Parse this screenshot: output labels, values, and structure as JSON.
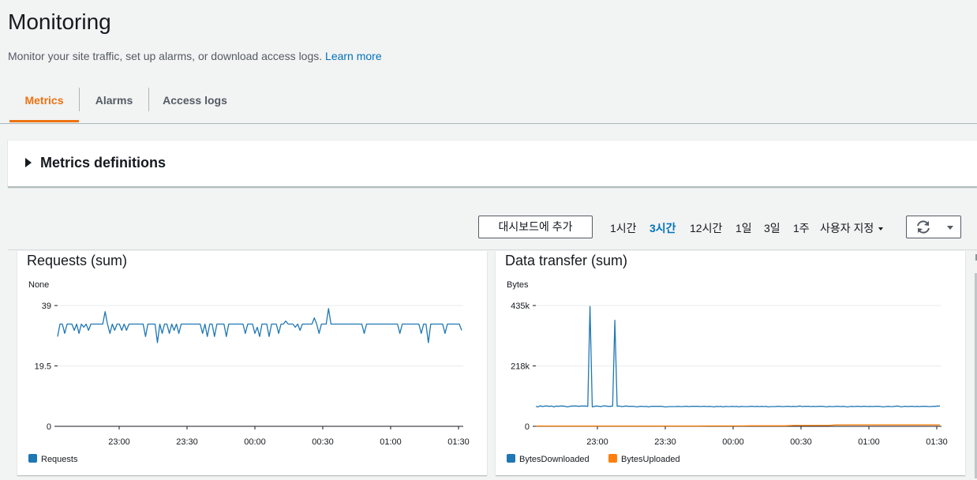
{
  "header": {
    "title": "Monitoring",
    "subtitle": "Monitor your site traffic, set up alarms, or download access logs.",
    "learn_more": "Learn more"
  },
  "tabs": [
    {
      "label": "Metrics",
      "active": true
    },
    {
      "label": "Alarms",
      "active": false
    },
    {
      "label": "Access logs",
      "active": false
    }
  ],
  "definitions": {
    "label": "Metrics definitions"
  },
  "toolbar": {
    "add_dashboard": "대시보드에 추가",
    "ranges": [
      "1시간",
      "3시간",
      "12시간",
      "1일",
      "3일",
      "1주"
    ],
    "active_range": "3시간",
    "custom": "사용자 지정"
  },
  "colors": {
    "accent": "#ec7211",
    "link": "#0073bb",
    "series1": "#1f77b4",
    "series2": "#ff7f0e"
  },
  "icons": {
    "refresh": "refresh-icon",
    "dropdown": "chevron-down-icon",
    "expand": "caret-right-icon"
  },
  "panels": [
    {
      "title": "Requests (sum)",
      "unit": "None",
      "legend": [
        "Requests"
      ]
    },
    {
      "title": "Data transfer (sum)",
      "unit": "Bytes",
      "legend": [
        "BytesDownloaded",
        "BytesUploaded"
      ]
    }
  ],
  "chart_data": [
    {
      "type": "line",
      "title": "Requests (sum)",
      "ylabel": "None",
      "ylim": [
        0,
        39
      ],
      "yticks": [
        "0",
        "19.5",
        "39"
      ],
      "xticks": [
        "23:00",
        "23:30",
        "00:00",
        "00:30",
        "01:00",
        "01:30"
      ],
      "grid": true,
      "legend_position": "bottom-left",
      "series": [
        {
          "name": "Requests",
          "color": "#1f77b4",
          "values": [
            29,
            33,
            33,
            30,
            33,
            33,
            33,
            31,
            33,
            30,
            33,
            32,
            33,
            31,
            33,
            33,
            33,
            33,
            33,
            33,
            37,
            33,
            30,
            33,
            31,
            33,
            33,
            31,
            33,
            31,
            33,
            33,
            33,
            33,
            33,
            33,
            33,
            29,
            33,
            33,
            33,
            33,
            27,
            33,
            30,
            33,
            33,
            30,
            33,
            31,
            33,
            30,
            33,
            33,
            33,
            33,
            33,
            33,
            33,
            33,
            33,
            30,
            33,
            29,
            33,
            33,
            29,
            33,
            33,
            33,
            33,
            29,
            33,
            33,
            33,
            33,
            33,
            33,
            33,
            30,
            33,
            33,
            33,
            30,
            32,
            29,
            33,
            33,
            33,
            29,
            33,
            33,
            33,
            30,
            33,
            33,
            34,
            33,
            33,
            33,
            32,
            33,
            31,
            33,
            33,
            33,
            33,
            33,
            35,
            33,
            30,
            33,
            33,
            33,
            38,
            33,
            33,
            33,
            33,
            33,
            33,
            33,
            33,
            33,
            33,
            33,
            33,
            33,
            33,
            30,
            33,
            33,
            33,
            33,
            33,
            33,
            33,
            33,
            33,
            33,
            33,
            33,
            33,
            33,
            30,
            33,
            33,
            33,
            33,
            33,
            33,
            33,
            33,
            30,
            33,
            33,
            27,
            33,
            33,
            33,
            33,
            33,
            33,
            30,
            33,
            33,
            33,
            33,
            33,
            33,
            31
          ]
        }
      ]
    },
    {
      "type": "line",
      "title": "Data transfer (sum)",
      "ylabel": "Bytes",
      "ylim": [
        0,
        435000
      ],
      "yticks": [
        "0",
        "218k",
        "435k"
      ],
      "xticks": [
        "23:00",
        "23:30",
        "00:00",
        "00:30",
        "01:00",
        "01:30"
      ],
      "grid": true,
      "legend_position": "bottom-left",
      "series": [
        {
          "name": "BytesDownloaded",
          "color": "#1f77b4",
          "values": [
            72000,
            70000,
            74000,
            71000,
            73000,
            73000,
            72000,
            73000,
            70000,
            73000,
            72000,
            73000,
            73000,
            72000,
            70000,
            72000,
            73000,
            73000,
            73000,
            72000,
            73000,
            73000,
            73000,
            72000,
            432000,
            70000,
            72000,
            73000,
            72000,
            71000,
            74000,
            73000,
            72000,
            72000,
            73000,
            382000,
            72000,
            73000,
            71000,
            72000,
            73000,
            72000,
            72000,
            72000,
            71000,
            70000,
            72000,
            72000,
            71000,
            72000,
            70000,
            72000,
            72000,
            72000,
            72000,
            72000,
            72000,
            70000,
            70000,
            71000,
            71000,
            71000,
            71000,
            72000,
            71000,
            71000,
            72000,
            72000,
            71000,
            72000,
            72000,
            72000,
            72000,
            71000,
            72000,
            72000,
            71000,
            72000,
            71000,
            70000,
            72000,
            71000,
            72000,
            70000,
            72000,
            71000,
            71000,
            72000,
            71000,
            72000,
            70000,
            72000,
            71000,
            71000,
            71000,
            72000,
            72000,
            71000,
            72000,
            71000,
            72000,
            71000,
            72000,
            70000,
            71000,
            71000,
            71000,
            72000,
            72000,
            71000,
            71000,
            72000,
            72000,
            71000,
            72000,
            71000,
            72000,
            73000,
            71000,
            72000,
            72000,
            72000,
            71000,
            72000,
            71000,
            72000,
            72000,
            72000,
            71000,
            70000,
            72000,
            71000,
            71000,
            72000,
            72000,
            71000,
            72000,
            71000,
            70000,
            71000,
            72000,
            71000,
            72000,
            72000,
            71000,
            72000,
            72000,
            71000,
            72000,
            71000,
            72000,
            72000,
            72000,
            71000,
            70000,
            71000,
            72000,
            71000,
            71000,
            72000,
            73000,
            72000,
            70000,
            72000,
            72000,
            71000,
            72000,
            72000,
            71000,
            72000,
            71000,
            72000,
            72000,
            72000,
            71000,
            71000,
            72000,
            72000,
            73000,
            73000
          ]
        },
        {
          "name": "BytesUploaded",
          "color": "#ff7f0e",
          "values": [
            1000,
            1000,
            1000,
            1000,
            1000,
            1000,
            1000,
            1000,
            1000,
            1000,
            1000,
            1000,
            1000,
            1000,
            1000,
            1000,
            1000,
            1000,
            1000,
            1000,
            1500,
            1500,
            1500,
            1500,
            1500,
            2000,
            2000,
            2000,
            2000,
            2000,
            3000,
            3000,
            3000,
            3000,
            3000,
            5000,
            5000,
            5000,
            5000,
            5000,
            5000,
            5000,
            5000,
            5000,
            5000,
            5000,
            5000,
            5000
          ]
        }
      ]
    }
  ]
}
